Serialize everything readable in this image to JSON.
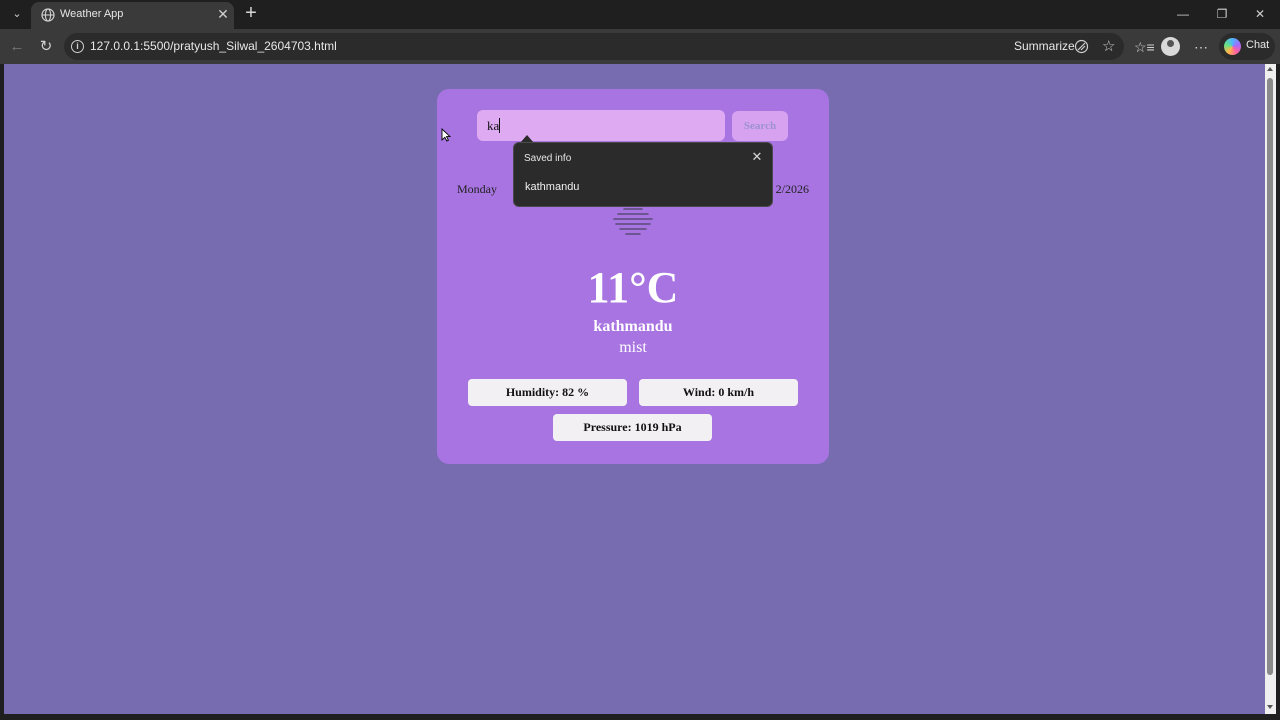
{
  "browser": {
    "tab_title": "Weather App",
    "url": "127.0.0.1:5500/pratyush_Silwal_2604703.html",
    "summarize_label": "Summarize",
    "chat_label": "Chat"
  },
  "weather": {
    "search_value": "ka",
    "search_button_label": "Search",
    "day": "Monday",
    "date": "2/2026",
    "temperature": "11°C",
    "city": "kathmandu",
    "condition": "mist",
    "icon": "mist-icon",
    "humidity": "Humidity: 82 %",
    "wind": "Wind: 0 km/h",
    "pressure": "Pressure: 1019 hPa"
  },
  "autofill": {
    "title": "Saved info",
    "items": [
      "kathmandu"
    ]
  },
  "colors": {
    "page_bg": "#786cb1",
    "card_bg": "#a774e1",
    "input_bg": "#deaaf2",
    "stat_bg": "#f2f0f2",
    "popup_bg": "#2b2b2b"
  }
}
